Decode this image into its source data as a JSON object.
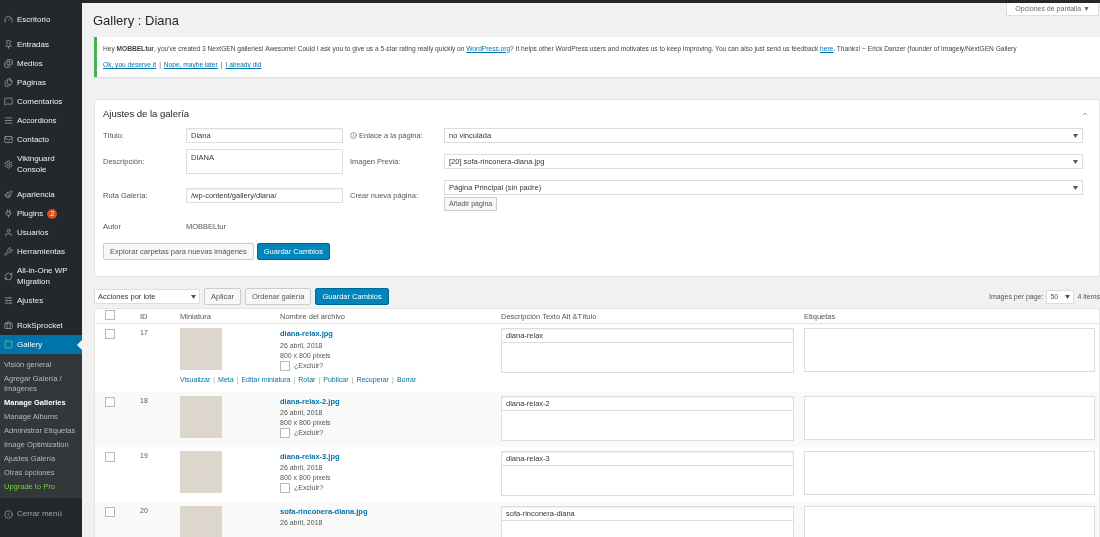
{
  "sidebar": {
    "groups": [
      {
        "items": [
          {
            "label": "Escritorio",
            "selected": false
          }
        ]
      },
      {
        "items": [
          {
            "label": "Entradas",
            "selected": false
          },
          {
            "label": "Medios",
            "selected": false
          },
          {
            "label": "Páginas",
            "selected": false
          },
          {
            "label": "Comentarios",
            "selected": false
          },
          {
            "label": "Accordions",
            "selected": false
          },
          {
            "label": "Contacto",
            "selected": false
          },
          {
            "label": "Vikinguard Console",
            "selected": false
          }
        ]
      },
      {
        "items": [
          {
            "label": "Apariencia",
            "selected": false
          },
          {
            "label": "Plugins",
            "badge": "2",
            "selected": false
          },
          {
            "label": "Usuarios",
            "selected": false
          },
          {
            "label": "Herramientas",
            "selected": false
          },
          {
            "label": "All-in-One WP Migration",
            "selected": false
          },
          {
            "label": "Ajustes",
            "selected": false
          }
        ]
      },
      {
        "items": [
          {
            "label": "RokSprocket",
            "selected": false
          },
          {
            "label": "Gallery",
            "selected": true,
            "submenu": [
              {
                "label": "Visión general",
                "kind": "normal",
                "selected": false
              },
              {
                "label": "Agregar Galería / Imágenes",
                "kind": "normal",
                "selected": false
              },
              {
                "label": "Manage Galleries",
                "kind": "normal",
                "selected": true
              },
              {
                "label": "Manage Albums",
                "kind": "normal",
                "selected": false
              },
              {
                "label": "Administrar Etiquetas",
                "kind": "normal",
                "selected": false
              },
              {
                "label": "Image Optimization",
                "kind": "normal",
                "selected": false
              },
              {
                "label": "Ajustes Galería",
                "kind": "normal",
                "selected": false
              },
              {
                "label": "Otras opciones",
                "kind": "normal",
                "selected": false
              },
              {
                "label": "Upgrade to Pro",
                "kind": "upgrade",
                "selected": false
              }
            ]
          }
        ]
      }
    ],
    "collapse": "Cerrar menú"
  },
  "screen_options": "Opciones de pantalla ▼",
  "page_title": "Gallery : Diana",
  "notice": {
    "message": [
      "Hey **MOBBELtur**, you've created 3 NextGEN galleries! Awesome! Could I ask you to give us a 5-star rating really quickly on ",
      {
        "link": "WordPress.org"
      },
      "? It helps other WordPress users and motivates us to keep improving. You can also just send us feedback ",
      {
        "link": "here"
      },
      ". Thanks! ~ Erick Danzer (founder of Imagely/NextGEN Gallery"
    ],
    "actions": [
      "Ok, you deserve it",
      "Nope, maybe later",
      "I already did"
    ],
    "separator": "|"
  },
  "settings": {
    "title": "Ajustes de la galería",
    "expanded": true,
    "title_label": "Título:",
    "title_value": "Diana",
    "description_label": "Descripción:",
    "description_value": "DIANA",
    "path_label": "Ruta Galería:",
    "path_value": "/wp-content/gallery/diana/",
    "author_label": "Autor",
    "author_value": "MOBBELtur",
    "link_label": "Enlace a la página:",
    "link_value": "no vinculada",
    "preview_label": "Imagen Previa:",
    "preview_value": "[20] sofa-rinconera-diana.jpg",
    "new_page_label": "Crear nueva página:",
    "new_page_value": "Página Principal (sin padre)",
    "add_page_button": "Añadir página",
    "buttons": [
      {
        "label": "Explorar carpetas para nuevas imágenes",
        "kind": "secondary"
      },
      {
        "label": "Guardar Cambios",
        "kind": "primary"
      }
    ]
  },
  "toolbar": {
    "bulk_actions": "Acciones por lote",
    "buttons": [
      {
        "label": "Aplicar",
        "kind": "secondary"
      },
      {
        "label": "Ordenar galería",
        "kind": "secondary"
      },
      {
        "label": "Guardar Cambios",
        "kind": "primary"
      }
    ],
    "per_page_label": "Images per page:",
    "per_page_value": "50",
    "count": "4 items"
  },
  "table": {
    "select_all_checked": false,
    "action_separator": "|",
    "columns": [
      "ID",
      "Miniatura",
      "Nombre del archivo",
      "Descripción Texto Alt &Título",
      "Etiquetas"
    ],
    "rows": [
      {
        "checked": false,
        "id": "17",
        "filename": "diana-relax.jpg",
        "date": "26 abril, 2018",
        "size": "800 x 800 pixels",
        "exclude_label": "¿Excluir?",
        "exclude": false,
        "alt": "diana-relax",
        "actions": [
          "Visualizar",
          "Meta",
          "Editar miniatura",
          "Rotar",
          "Publicar",
          "Recuperar",
          "Borrar"
        ]
      },
      {
        "checked": false,
        "id": "18",
        "filename": "diana-relax-2.jpg",
        "date": "26 abril, 2018",
        "size": "800 x 800 pixels",
        "exclude_label": "¿Excluir?",
        "exclude": false,
        "alt": "diana-relax-2"
      },
      {
        "checked": false,
        "id": "19",
        "filename": "diana-relax-3.jpg",
        "date": "26 abril, 2018",
        "size": "800 x 800 pixels",
        "exclude_label": "¿Excluir?",
        "exclude": false,
        "alt": "diana-relax-3"
      },
      {
        "checked": false,
        "id": "20",
        "filename": "sofa-rinconera-diana.jpg",
        "date": "26 abril, 2018",
        "alt": "sofa-rinconera-diana"
      }
    ]
  }
}
